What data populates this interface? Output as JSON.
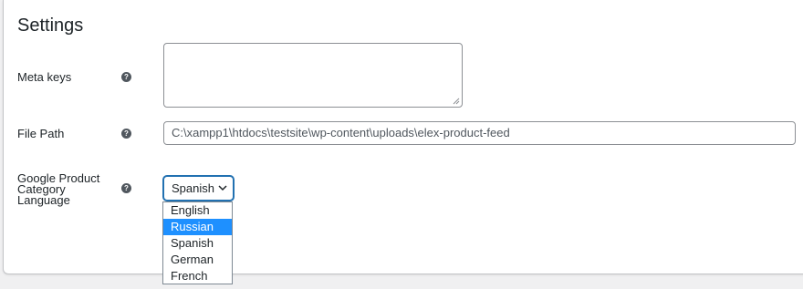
{
  "settings": {
    "title": "Settings",
    "meta_keys": {
      "label": "Meta keys",
      "value": ""
    },
    "file_path": {
      "label": "File Path",
      "value": "C:\\xampp1\\htdocs\\testsite\\wp-content\\uploads\\elex-product-feed"
    },
    "language": {
      "label_lines": [
        "Google Product",
        "Category",
        "Language"
      ],
      "selected": "Spanish",
      "options": [
        "English",
        "Russian",
        "Spanish",
        "German",
        "French"
      ],
      "highlighted": "Russian"
    },
    "help_icon_glyph": "?"
  },
  "colors": {
    "focus_border": "#2271b1",
    "option_highlight": "#1e90ff",
    "help_icon_bg": "#50575e"
  }
}
